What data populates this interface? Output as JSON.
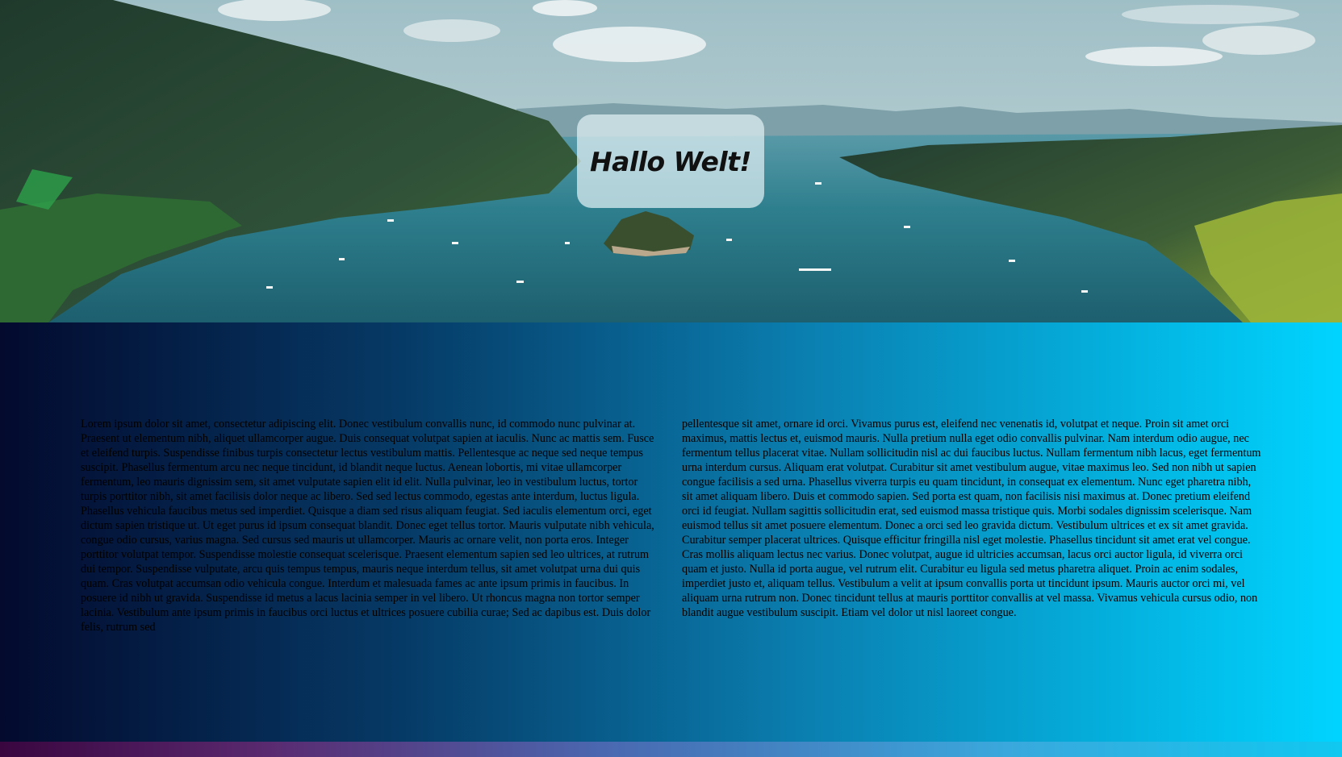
{
  "hero": {
    "heading": "Hallo Welt!"
  },
  "content": {
    "column_left": "Lorem ipsum dolor sit amet, consectetur adipiscing elit. Donec vestibulum convallis nunc, id commodo nunc pulvinar at. Praesent ut elementum nibh, aliquet ullamcorper augue. Duis consequat volutpat sapien at iaculis. Nunc ac mattis sem. Fusce et eleifend turpis. Suspendisse finibus turpis consectetur lectus vestibulum mattis. Pellentesque ac neque sed neque tempus suscipit. Phasellus fermentum arcu nec neque tincidunt, id blandit neque luctus. Aenean lobortis, mi vitae ullamcorper fermentum, leo mauris dignissim sem, sit amet vulputate sapien elit id elit. Nulla pulvinar, leo in vestibulum luctus, tortor turpis porttitor nibh, sit amet facilisis dolor neque ac libero. Sed sed lectus commodo, egestas ante interdum, luctus ligula. Phasellus vehicula faucibus metus sed imperdiet. Quisque a diam sed risus aliquam feugiat. Sed iaculis elementum orci, eget dictum sapien tristique ut. Ut eget purus id ipsum consequat blandit. Donec eget tellus tortor. Mauris vulputate nibh vehicula, congue odio cursus, varius magna. Sed cursus sed mauris ut ullamcorper. Mauris ac ornare velit, non porta eros. Integer porttitor volutpat tempor. Suspendisse molestie consequat scelerisque. Praesent elementum sapien sed leo ultrices, at rutrum dui tempor. Suspendisse vulputate, arcu quis tempus tempus, mauris neque interdum tellus, sit amet volutpat urna dui quis quam. Cras volutpat accumsan odio vehicula congue. Interdum et malesuada fames ac ante ipsum primis in faucibus. In posuere id nibh ut gravida. Suspendisse id metus a lacus lacinia semper in vel libero. Ut rhoncus magna non tortor semper lacinia. Vestibulum ante ipsum primis in faucibus orci luctus et ultrices posuere cubilia curae; Sed ac dapibus est. Duis dolor felis, rutrum sed",
    "column_right": "pellentesque sit amet, ornare id orci. Vivamus purus est, eleifend nec venenatis id, volutpat et neque. Proin sit amet orci maximus, mattis lectus et, euismod mauris. Nulla pretium nulla eget odio convallis pulvinar. Nam interdum odio augue, nec fermentum tellus placerat vitae. Nullam sollicitudin nisl ac dui faucibus luctus. Nullam fermentum nibh lacus, eget fermentum urna interdum cursus. Aliquam erat volutpat. Curabitur sit amet vestibulum augue, vitae maximus leo. Sed non nibh ut sapien congue facilisis a sed urna. Phasellus viverra turpis eu quam tincidunt, in consequat ex elementum. Nunc eget pharetra nibh, sit amet aliquam libero. Duis et commodo sapien. Sed porta est quam, non facilisis nisi maximus at. Donec pretium eleifend orci id feugiat. Nullam sagittis sollicitudin erat, sed euismod massa tristique quis. Morbi sodales dignissim scelerisque. Nam euismod tellus sit amet posuere elementum. Donec a orci sed leo gravida dictum. Vestibulum ultrices et ex sit amet gravida. Curabitur semper placerat ultrices. Quisque efficitur fringilla nisl eget molestie. Phasellus tincidunt sit amet erat vel congue. Cras mollis aliquam lectus nec varius. Donec volutpat, augue id ultricies accumsan, lacus orci auctor ligula, id viverra orci quam et justo. Nulla id porta augue, vel rutrum elit. Curabitur eu ligula sed metus pharetra aliquet. Proin ac enim sodales, imperdiet justo et, aliquam tellus. Vestibulum a velit at ipsum convallis porta ut tincidunt ipsum. Mauris auctor orci mi, vel aliquam urna rutrum non. Donec tincidunt tellus at mauris porttitor convallis at vel massa. Vivamus vehicula cursus odio, non blandit augue vestibulum suscipit. Etiam vel dolor ut nisl laoreet congue."
  },
  "colors": {
    "gradient_start": "#030a2e",
    "gradient_end": "#00d4ff",
    "lake": "#2a7f8f",
    "forest": "#2c4a35"
  }
}
